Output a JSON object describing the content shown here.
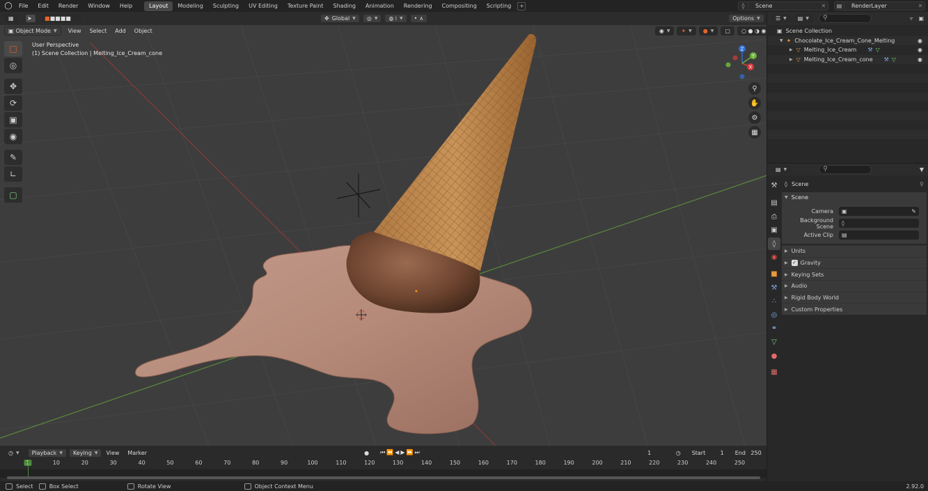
{
  "menu": {
    "items": [
      "File",
      "Edit",
      "Render",
      "Window",
      "Help"
    ]
  },
  "workspaces": {
    "tabs": [
      "Layout",
      "Modeling",
      "Sculpting",
      "UV Editing",
      "Texture Paint",
      "Shading",
      "Animation",
      "Rendering",
      "Compositing",
      "Scripting"
    ],
    "active": "Layout"
  },
  "scene_selector": {
    "scene": "Scene",
    "view_layer": "RenderLayer"
  },
  "viewport_header": {
    "transform_orientation": "Global",
    "options": "Options",
    "mode": "Object Mode",
    "menus": [
      "View",
      "Select",
      "Add",
      "Object"
    ]
  },
  "viewport_overlay": {
    "perspective": "User Perspective",
    "collection_info": "(1) Scene Collection | Melting_Ice_Cream_cone"
  },
  "gizmo_axes": {
    "x": "X",
    "y": "Y",
    "z": "Z"
  },
  "timeline": {
    "menus": [
      "Playback",
      "Keying",
      "View",
      "Marker"
    ],
    "current_frame": "1",
    "start_label": "Start",
    "start": "1",
    "end_label": "End",
    "end": "250",
    "ruler": [
      "1",
      "10",
      "20",
      "30",
      "40",
      "50",
      "60",
      "70",
      "80",
      "90",
      "100",
      "110",
      "120",
      "130",
      "140",
      "150",
      "160",
      "170",
      "180",
      "190",
      "200",
      "210",
      "220",
      "230",
      "240",
      "250"
    ]
  },
  "statusbar": {
    "select": "Select",
    "box_select": "Box Select",
    "rotate_view": "Rotate View",
    "context_menu": "Object Context Menu",
    "version": "2.92.0"
  },
  "outliner": {
    "root": "Scene Collection",
    "items": [
      {
        "label": "Chocolate_Ice_Cream_Cone_Melting",
        "level": 1
      },
      {
        "label": "Melting_Ice_Cream",
        "level": 2
      },
      {
        "label": "Melting_Ice_Cream_cone",
        "level": 2
      }
    ]
  },
  "properties": {
    "context": "Scene",
    "panel": "Scene",
    "fields": [
      {
        "label": "Camera"
      },
      {
        "label": "Background Scene"
      },
      {
        "label": "Active Clip"
      }
    ],
    "subpanels": [
      "Units",
      "Gravity",
      "Keying Sets",
      "Audio",
      "Rigid Body World",
      "Custom Properties"
    ],
    "gravity_enabled": true
  }
}
